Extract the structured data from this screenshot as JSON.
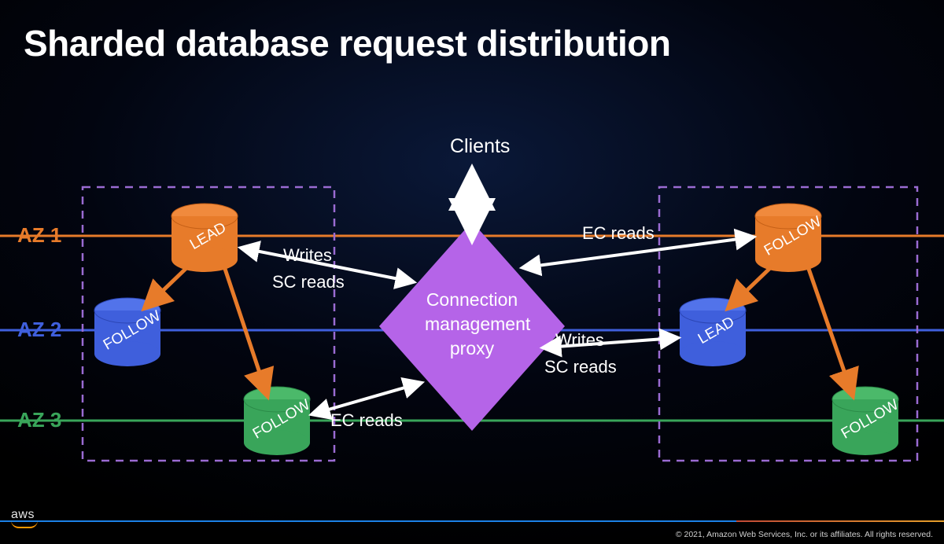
{
  "title": "Sharded database request distribution",
  "labels": {
    "clients": "Clients",
    "az1": "AZ 1",
    "az2": "AZ 2",
    "az3": "AZ 3",
    "proxy_l1": "Connection",
    "proxy_l2": "management",
    "proxy_l3": "proxy",
    "writes": "Writes",
    "sc_reads": "SC reads",
    "ec_reads": "EC reads"
  },
  "db": {
    "left": {
      "az1": "LEAD",
      "az2": "FOLLOW",
      "az3": "FOLLOW"
    },
    "right": {
      "az1": "FOLLOW",
      "az2": "LEAD",
      "az3": "FOLLOW"
    }
  },
  "colors": {
    "az1": "#e77b2a",
    "az2": "#3f5fdc",
    "az3": "#39a55a",
    "proxy": "#b564e8",
    "dashed": "#9a6bd2"
  },
  "footer": {
    "logo": "aws",
    "copyright": "© 2021, Amazon Web Services, Inc. or its affiliates. All rights reserved."
  }
}
